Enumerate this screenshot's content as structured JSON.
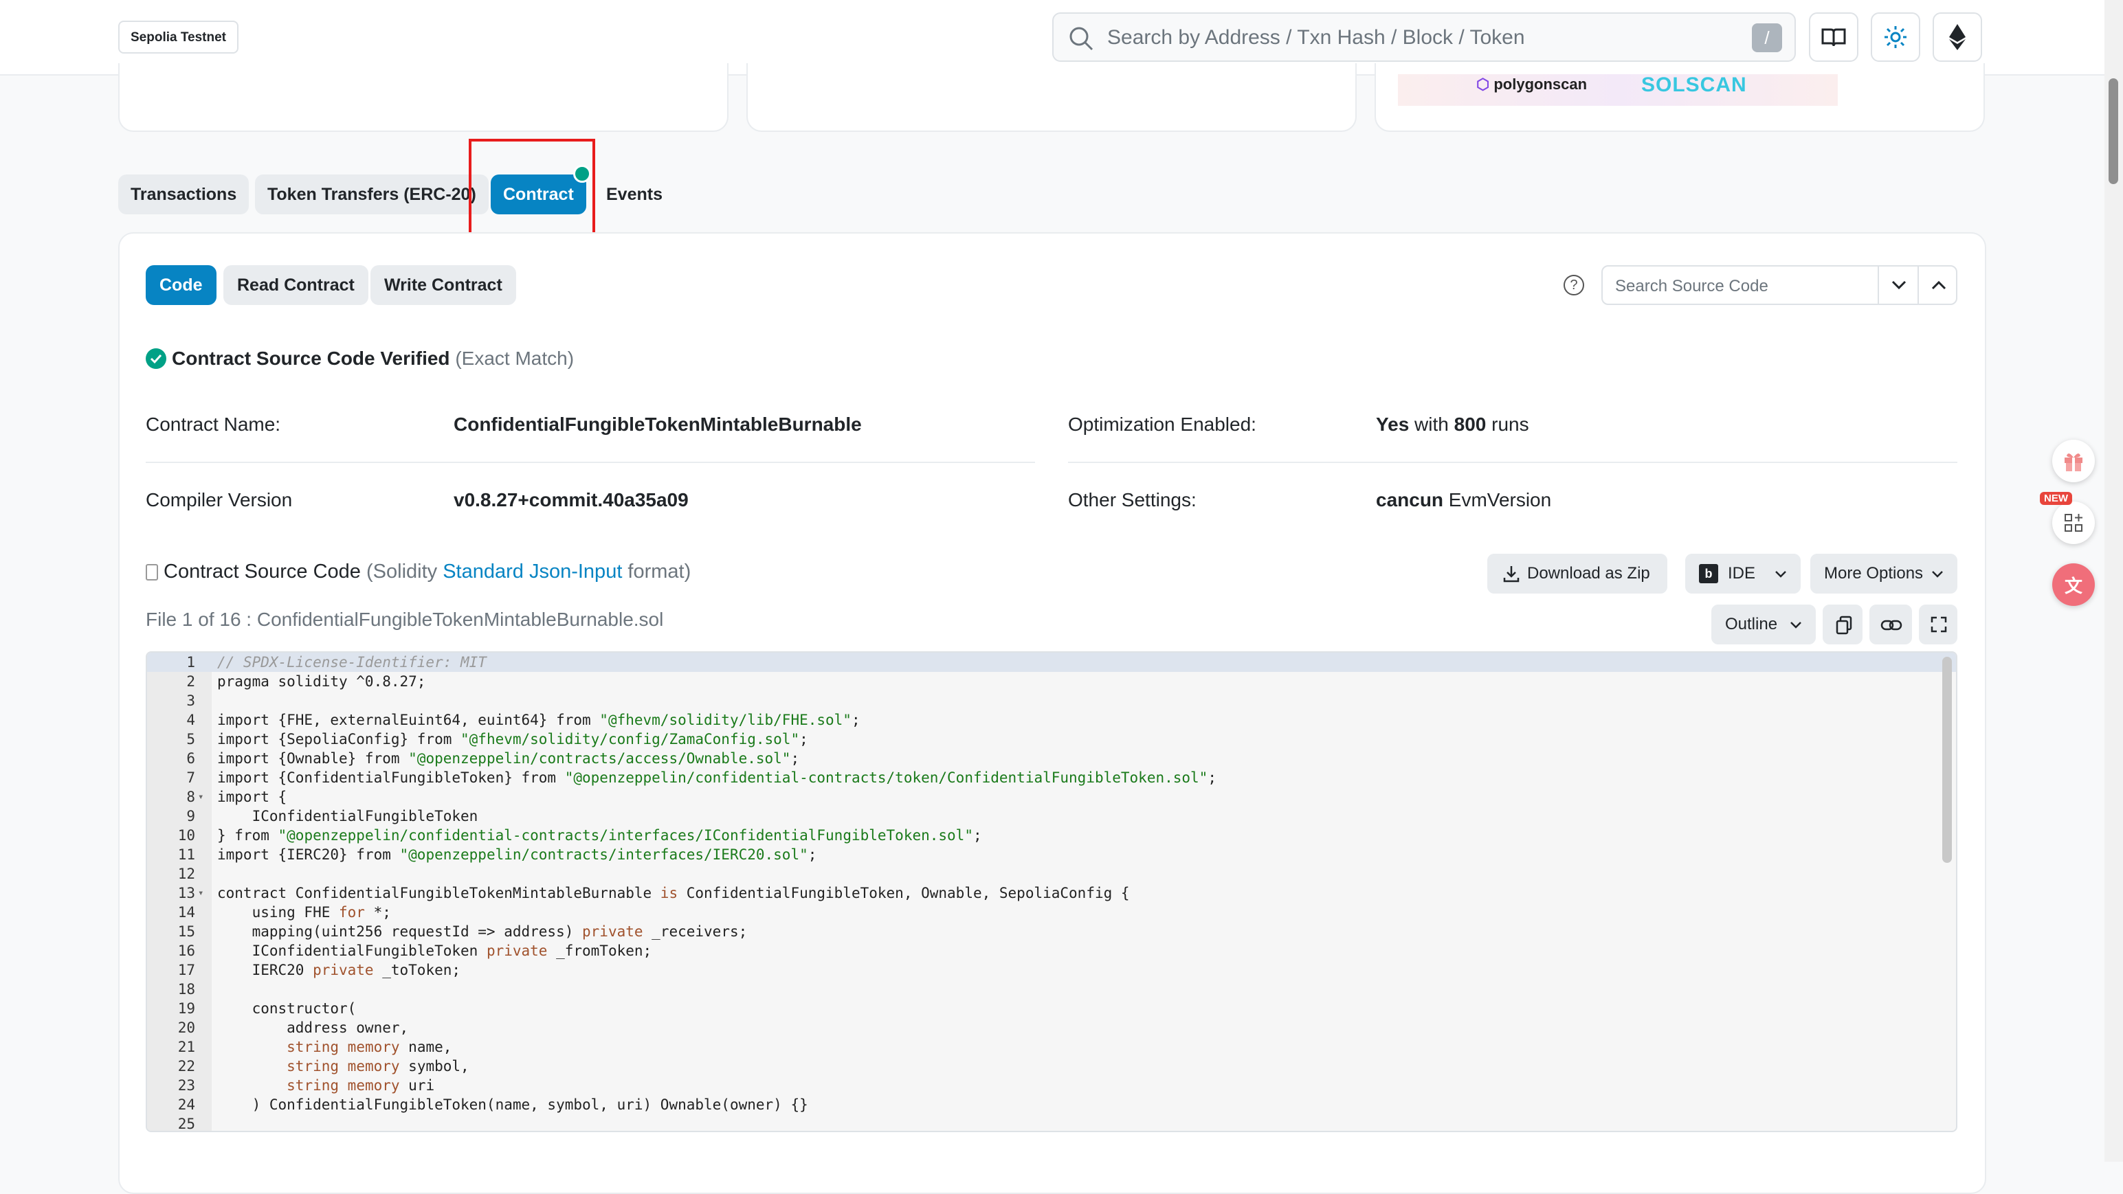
{
  "header": {
    "network": "Sepolia Testnet",
    "search_placeholder": "Search by Address / Txn Hash / Block / Token",
    "search_shortcut": "/"
  },
  "banner": {
    "sponsor_1": "polygonscan",
    "sponsor_2": "SOLSCAN"
  },
  "tabs": [
    {
      "label": "Transactions"
    },
    {
      "label": "Token Transfers (ERC-20)"
    },
    {
      "label": "Contract",
      "active": true,
      "verified": true
    },
    {
      "label": "Events"
    }
  ],
  "subtabs": [
    "Code",
    "Read Contract",
    "Write Contract"
  ],
  "source_search_placeholder": "Search Source Code",
  "verified": {
    "title": "Contract Source Code Verified",
    "note": "(Exact Match)"
  },
  "details": {
    "contract_name_label": "Contract Name:",
    "contract_name": "ConfidentialFungibleTokenMintableBurnable",
    "optimization_label": "Optimization Enabled:",
    "optimization_yes": "Yes",
    "optimization_with": " with ",
    "optimization_runs": "800",
    "optimization_suffix": " runs",
    "compiler_label": "Compiler Version",
    "compiler_value": "v0.8.27+commit.40a35a09",
    "other_label": "Other Settings:",
    "other_evm": "cancun",
    "other_suffix": " EvmVersion"
  },
  "source": {
    "title": "Contract Source Code",
    "format_open": " (Solidity ",
    "format_link": "Standard Json-Input",
    "format_close": " format)",
    "file_line": "File 1 of 16 : ConfidentialFungibleTokenMintableBurnable.sol",
    "download": "Download as Zip",
    "ide": "IDE",
    "more": "More Options",
    "outline": "Outline"
  },
  "code": [
    "// SPDX-License-Identifier: MIT",
    "pragma solidity ^0.8.27;",
    "",
    "import {FHE, externalEuint64, euint64} from \"@fhevm/solidity/lib/FHE.sol\";",
    "import {SepoliaConfig} from \"@fhevm/solidity/config/ZamaConfig.sol\";",
    "import {Ownable} from \"@openzeppelin/contracts/access/Ownable.sol\";",
    "import {ConfidentialFungibleToken} from \"@openzeppelin/confidential-contracts/token/ConfidentialFungibleToken.sol\";",
    "import {",
    "    IConfidentialFungibleToken",
    "} from \"@openzeppelin/confidential-contracts/interfaces/IConfidentialFungibleToken.sol\";",
    "import {IERC20} from \"@openzeppelin/contracts/interfaces/IERC20.sol\";",
    "",
    "contract ConfidentialFungibleTokenMintableBurnable is ConfidentialFungibleToken, Ownable, SepoliaConfig {",
    "    using FHE for *;",
    "    mapping(uint256 requestId => address) private _receivers;",
    "    IConfidentialFungibleToken private _fromToken;",
    "    IERC20 private _toToken;",
    "",
    "    constructor(",
    "        address owner,",
    "        string memory name,",
    "        string memory symbol,",
    "        string memory uri",
    "    ) ConfidentialFungibleToken(name, symbol, uri) Ownable(owner) {}",
    ""
  ],
  "float_badge": "NEW"
}
